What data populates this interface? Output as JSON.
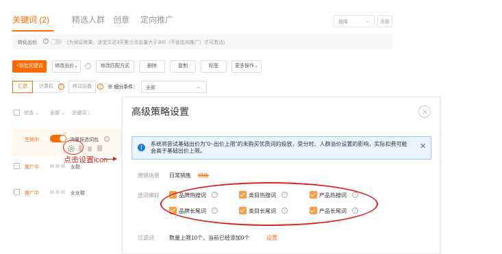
{
  "tabs": [
    {
      "label": "关键词 (2)",
      "active": true
    },
    {
      "label": "精选人群",
      "active": false
    },
    {
      "label": "创意",
      "active": false
    },
    {
      "label": "定向推广",
      "active": false
    }
  ],
  "top_right": {
    "select_value": "按降",
    "button_label": "关联"
  },
  "conversion_bar": {
    "label": "转化出价",
    "question": "?",
    "hint": "(为保证效果，该宝贝近3天累计点击量大于300（不含定向推广）才可激活)"
  },
  "toolbar": {
    "add_keyword": "+添加关键词",
    "modify_bid": "修改出价",
    "question": "?",
    "match_mode": "修改匹配方式",
    "delete": "删除",
    "copy": "复制",
    "tag": "标签",
    "more": "更多操作"
  },
  "filter_bar": {
    "summary": "汇总",
    "computer": "计算机",
    "mobile": "移动设备",
    "question": "?",
    "condition_label": "细分条件：",
    "condition_value": "全部"
  },
  "table": {
    "header": {
      "status": "状态",
      "all": "全部",
      "keyword": "关键词"
    },
    "rows": [
      {
        "status": "生效中",
        "keyword": "流量智选词包"
      },
      {
        "status": "推广中",
        "keyword": "女鞋"
      },
      {
        "status": "推广中",
        "keyword": "女女鞋"
      }
    ]
  },
  "annotation": {
    "text": "点击设置icon",
    "color": "#d7261e"
  },
  "modal": {
    "title": "高级策略设置",
    "alert": "系统将尝试基础出价为“0~出价上限”的未购买优质词的投放，受分时、人群溢价设置的影响，实际扣费可能会高于基础出价上限。",
    "marketing_label": "营销场景",
    "marketing_value": "日常销售",
    "marketing_link": "修改",
    "pref_label": "选词偏好",
    "options": [
      "品牌热搜词",
      "类目热搜词",
      "产品热搜词",
      "品牌长尾词",
      "类目长尾词",
      "产品长尾词"
    ],
    "filter_label": "过滤词",
    "filter_text": "数量上限10个，当前已经添加0个",
    "filter_link": "设置"
  },
  "colors": {
    "accent": "#ff6a00",
    "info": "#1d78e6",
    "annotation": "#d7261e"
  }
}
